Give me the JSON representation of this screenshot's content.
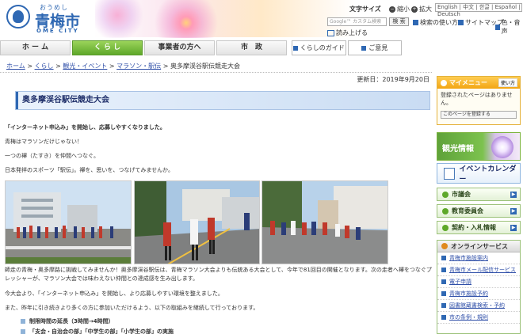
{
  "header": {
    "logo_ruby": "おうめし",
    "logo_name": "青梅市",
    "logo_en": "OME CITY",
    "font_size_label": "文字サイズ",
    "font_shrink": "縮小",
    "font_enlarge": "拡大",
    "languages": "English | 中文 | 한글 | Español | Deutsch",
    "search_placeholder": "Google™ カスタム検索",
    "search_button": "検 索",
    "search_howto": "検索の使い方",
    "sitemap": "サイトマップ",
    "color": "色・音声",
    "readout": "読み上げる"
  },
  "nav": {
    "items": [
      {
        "label": "ホ ー ム"
      },
      {
        "label": "く ら し"
      },
      {
        "label": "事業者の方へ"
      },
      {
        "label": "市　政"
      }
    ],
    "guide": "くらしのガイド",
    "opinion": "ご意見"
  },
  "breadcrumb": {
    "home": "ホーム",
    "kurashi": "くらし",
    "kanko": "観光・イベント",
    "marathon": "マラソン・駅伝",
    "current": "奥多摩渓谷駅伝競走大会",
    "sep": ">"
  },
  "page": {
    "updated": "更新日：2019年9月20日",
    "title": "奥多摩渓谷駅伝競走大会",
    "lead": "「インターネット申込み」を開始し、応募しやすくなりました。",
    "line1": "青梅はマラソンだけじゃない！",
    "line2": "一つの襷（たすき）を仲間へつなぐ。",
    "line3": "日本発祥のスポーツ「駅伝」。襷を、思いを、つなげてみませんか。",
    "caption": "師走の青梅・奥多摩路に挑戦してみませんか！奥多摩渓谷駅伝は、青梅マラソン大会よりも伝統ある大会として、今年で81回目の開催となります。次の走者へ襷をつなぐプレッシャーが、マラソン大会では味わえない仲間との達成感を生み出します。",
    "line4": "今大会より、「インターネット申込み」を開始し、より応募しやすい環境を整えました。",
    "line5": "また、昨年に引き続きより多くの方に参加いただけるよう、以下の取組みを継続して行っております。",
    "bullets": [
      "制限時間の延長（3時間→4時間）",
      "「支会・自治会の部」「中学生の部」「小学生の部」の実施"
    ]
  },
  "sidebar": {
    "mymenu_title": "マイメニュー",
    "mymenu_howto": "使い方",
    "mymenu_text": "登録されたページはありません。",
    "mymenu_register": "このページを登録する",
    "tourism": "観光情報",
    "calendar": "イベントカレンダー",
    "links": [
      "市議会",
      "教育委員会",
      "契約・入札情報"
    ],
    "online_title": "オンラインサービス",
    "online_items": [
      "青梅市施設案内",
      "青梅市メール配信サービス",
      "電子申請",
      "青梅市施設予約",
      "図書館蔵書検索・予約",
      "市の条例・規則"
    ]
  }
}
